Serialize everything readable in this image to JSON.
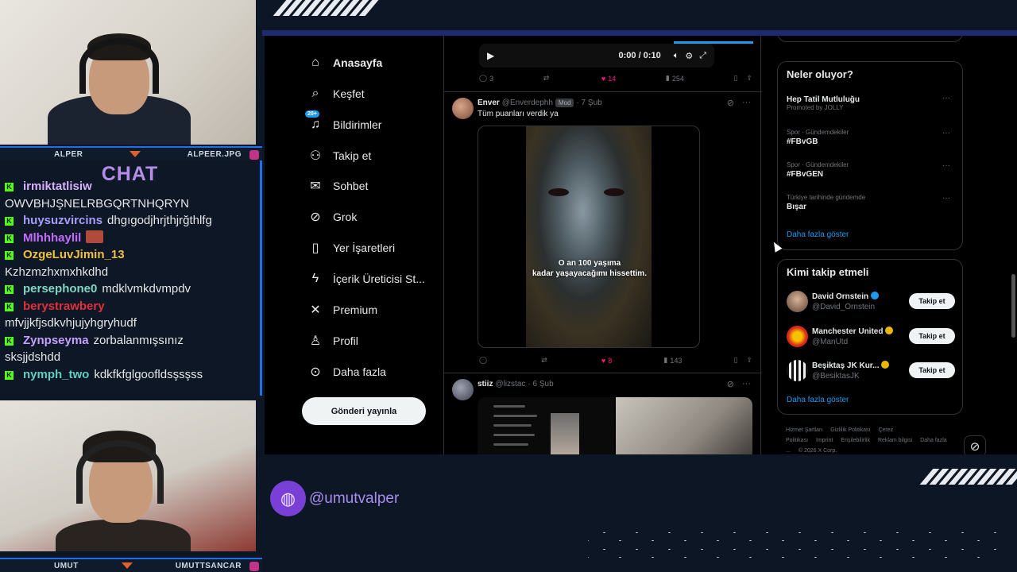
{
  "overlay": {
    "cam_top_label_left": "ALPER",
    "cam_top_label_right": "ALPEER.JPG",
    "cam_bottom_label_left": "UMUT",
    "cam_bottom_label_right": "UMUTTSANCAR",
    "chat_title": "CHAT",
    "chat": [
      {
        "user": "irmiktatlisiw",
        "msg": "",
        "color": "#d8b0ff"
      },
      {
        "user": "",
        "msg": "OWVBHJŞNELRBGQRTNHQRYN",
        "color": ""
      },
      {
        "user": "huysuzvircins",
        "msg": "dhgıgodjhrjthjrğthlfg",
        "color": "#a89cff"
      },
      {
        "user": "Mlhhhaylil",
        "msg": "",
        "color": "#c66bff"
      },
      {
        "user": "OzgeLuvJimin_13",
        "msg": "",
        "color": "#f0c040"
      },
      {
        "user": "",
        "msg": "Kzhzmzhxmxhkdhd",
        "color": ""
      },
      {
        "user": "persephone0",
        "msg": "mdklvmkdvmpdv",
        "color": "#7fd7c4"
      },
      {
        "user": "berystrawbery",
        "msg": "",
        "color": "#e0303a"
      },
      {
        "user": "",
        "msg": "mfvjjkfjsdkvhjujyhgryhudf",
        "color": ""
      },
      {
        "user": "Zynpseyma",
        "msg": "zorbalanmışsınız",
        "color": "#c8a0ff"
      },
      {
        "user": "",
        "msg": "sksjjdshdd",
        "color": ""
      },
      {
        "user": "nymph_two",
        "msg": "kdkfkfglgoofldsşsşss",
        "color": "#5fd0c0"
      }
    ],
    "social_handle": "@umutvalper"
  },
  "nav": {
    "items": [
      {
        "label": "Anasayfa",
        "icon": "home-icon",
        "glyph": "⌂"
      },
      {
        "label": "Keşfet",
        "icon": "search-icon",
        "glyph": "⌕"
      },
      {
        "label": "Bildirimler",
        "icon": "bell-icon",
        "glyph": "♫"
      },
      {
        "label": "Takip et",
        "icon": "add-user-icon",
        "glyph": "⚇"
      },
      {
        "label": "Sohbet",
        "icon": "mail-icon",
        "glyph": "✉"
      },
      {
        "label": "Grok",
        "icon": "grok-icon",
        "glyph": "⊘"
      },
      {
        "label": "Yer İşaretleri",
        "icon": "bookmark-icon",
        "glyph": "▯"
      },
      {
        "label": "İçerik Üreticisi St...",
        "icon": "lightning-icon",
        "glyph": "ϟ"
      },
      {
        "label": "Premium",
        "icon": "x-logo-icon",
        "glyph": "✕"
      },
      {
        "label": "Profil",
        "icon": "person-icon",
        "glyph": "♙"
      },
      {
        "label": "Daha fazla",
        "icon": "more-circle-icon",
        "glyph": "⊙"
      }
    ],
    "notif_badge": "20+",
    "post_button": "Gönderi yayınla"
  },
  "feed": {
    "video_time": "0:00 / 0:10",
    "tweet0_actions": {
      "replies": "3",
      "retweets": "",
      "likes": "14",
      "views": "254"
    },
    "tweet1": {
      "name": "Enver",
      "handle": "@Enverdephh",
      "badge": "Mod",
      "time": "· 7 Şub",
      "text": "Tüm puanları verdik ya",
      "caption_line1": "O an 100 yaşıma",
      "caption_line2": "kadar yaşayacağımı hissettim.",
      "actions": {
        "replies": "",
        "retweets": "",
        "likes": "8",
        "views": "143"
      }
    },
    "tweet2": {
      "name": "stiiz",
      "handle": "@lizstac",
      "time": "· 6 Şub"
    }
  },
  "sidebar": {
    "trends_title": "Neler oluyor?",
    "trends": [
      {
        "category": "",
        "title": "Hep Tatil Mutluluğu",
        "sub": "Promoted by JOLLY"
      },
      {
        "category": "Spor · Gündemdekiler",
        "title": "#FBvGB",
        "sub": ""
      },
      {
        "category": "Spor · Gündemdekiler",
        "title": "#FBvGEN",
        "sub": ""
      },
      {
        "category": "Türkiye tarihinde gündemde",
        "title": "Bışar",
        "sub": ""
      }
    ],
    "trends_more": "Daha fazla göster",
    "follow_title": "Kimi takip etmeli",
    "follow": [
      {
        "name": "David Ornstein",
        "handle": "@David_Ornstein",
        "button": "Takip et",
        "verified": "#1d9bf0"
      },
      {
        "name": "Manchester United",
        "handle": "@ManUtd",
        "button": "Takip et",
        "verified": "#e8b800"
      },
      {
        "name": "Beşiktaş JK Kur...",
        "handle": "@BesiktasJK",
        "button": "Takip et",
        "verified": "#e8b800"
      }
    ],
    "follow_more": "Daha fazla göster",
    "footer": [
      "Hizmet Şartları",
      "Gizlilik Politikası",
      "Çerez Politikası",
      "Imprint",
      "Erişilebilirlik",
      "Reklam bilgisi",
      "Daha fazla ...",
      "© 2026 X Corp."
    ]
  }
}
